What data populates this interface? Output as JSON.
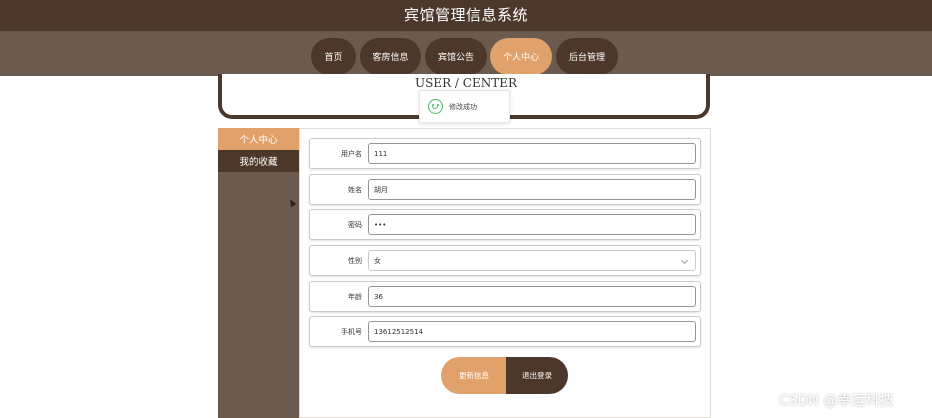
{
  "site_title": "宾馆管理信息系统",
  "nav": [
    {
      "label": "首页",
      "active": false
    },
    {
      "label": "客房信息",
      "active": false
    },
    {
      "label": "宾馆公告",
      "active": false
    },
    {
      "label": "个人中心",
      "active": true
    },
    {
      "label": "后台管理",
      "active": false
    }
  ],
  "page_title": "USER / CENTER",
  "toast": {
    "message": "修改成功",
    "icon": "smile-icon"
  },
  "sidebar": {
    "items": [
      {
        "label": "个人中心",
        "active": true
      },
      {
        "label": "我的收藏",
        "active": false
      }
    ]
  },
  "form": {
    "username": {
      "label": "用户名",
      "value": "111"
    },
    "name": {
      "label": "姓名",
      "value": "胡月"
    },
    "password": {
      "label": "密码",
      "value": "•••"
    },
    "gender": {
      "label": "性别",
      "value": "女"
    },
    "age": {
      "label": "年龄",
      "value": "36"
    },
    "phone": {
      "label": "手机号",
      "value": "13612512514"
    }
  },
  "buttons": {
    "update": "更新信息",
    "logout": "退出登录"
  },
  "watermark": "CSDN @幸运科技",
  "colors": {
    "dark_brown": "#4c382a",
    "mid_brown": "#6b5a4e",
    "accent": "#e0a16b"
  }
}
